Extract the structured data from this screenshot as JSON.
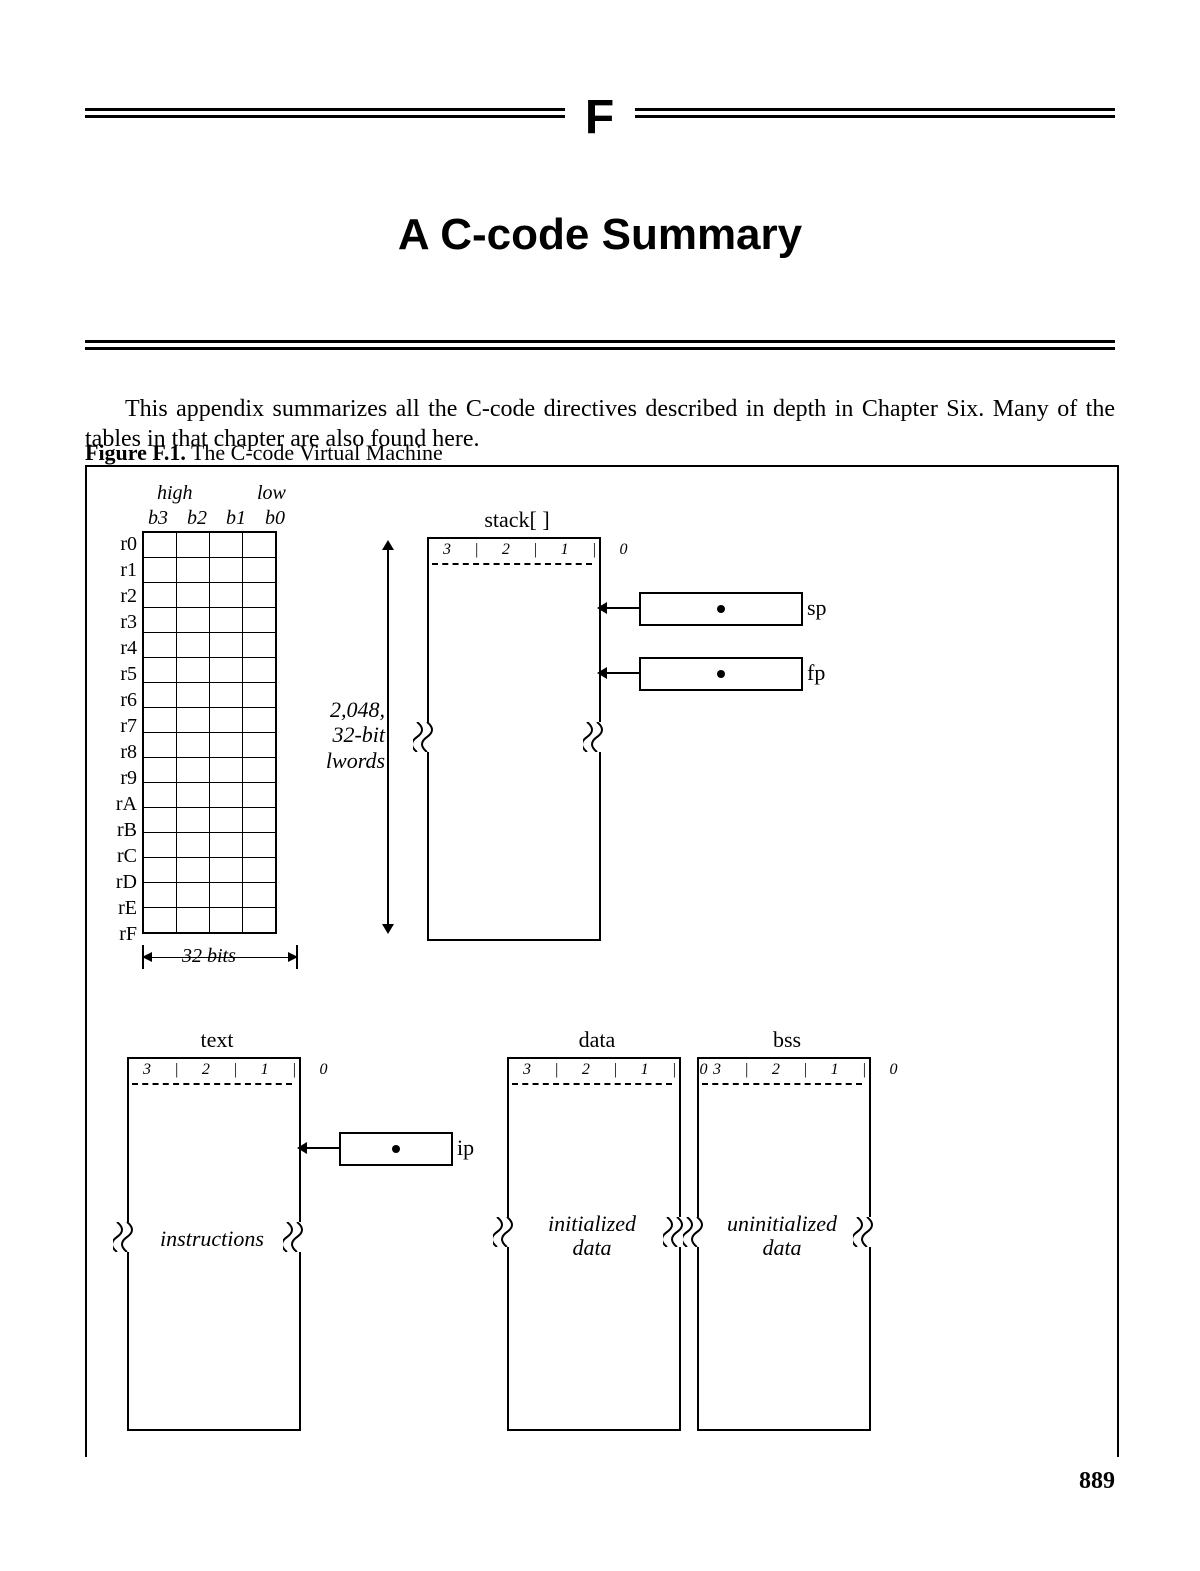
{
  "chapter_letter": "F",
  "chapter_title": "A C-code Summary",
  "body_paragraph": "This appendix summarizes all the C-code directives described in depth in Chapter Six. Many of the tables in that chapter are also found here.",
  "figure_label": "Figure F.1.",
  "figure_title": "The C-code Virtual Machine",
  "page_number": "889",
  "registers": {
    "high_label": "high",
    "low_label": "low",
    "byte_headers": [
      "b3",
      "b2",
      "b1",
      "b0"
    ],
    "names": [
      "r0",
      "r1",
      "r2",
      "r3",
      "r4",
      "r5",
      "r6",
      "r7",
      "r8",
      "r9",
      "rA",
      "rB",
      "rC",
      "rD",
      "rE",
      "rF"
    ],
    "width_label": "32 bits"
  },
  "stack": {
    "title": "stack[ ]",
    "byte_ticks": [
      "3",
      "2",
      "1",
      "0"
    ],
    "size_label_1": "2,048,",
    "size_label_2": "32-bit",
    "size_label_3": "lwords",
    "sp_label": "sp",
    "fp_label": "fp"
  },
  "segments": {
    "text": {
      "title": "text",
      "byte_ticks": [
        "3",
        "2",
        "1",
        "0"
      ],
      "desc": "instructions",
      "ip_label": "ip"
    },
    "data": {
      "title": "data",
      "byte_ticks": [
        "3",
        "2",
        "1",
        "0"
      ],
      "desc_1": "initialized",
      "desc_2": "data"
    },
    "bss": {
      "title": "bss",
      "byte_ticks": [
        "3",
        "2",
        "1",
        "0"
      ],
      "desc_1": "uninitialized",
      "desc_2": "data"
    }
  }
}
